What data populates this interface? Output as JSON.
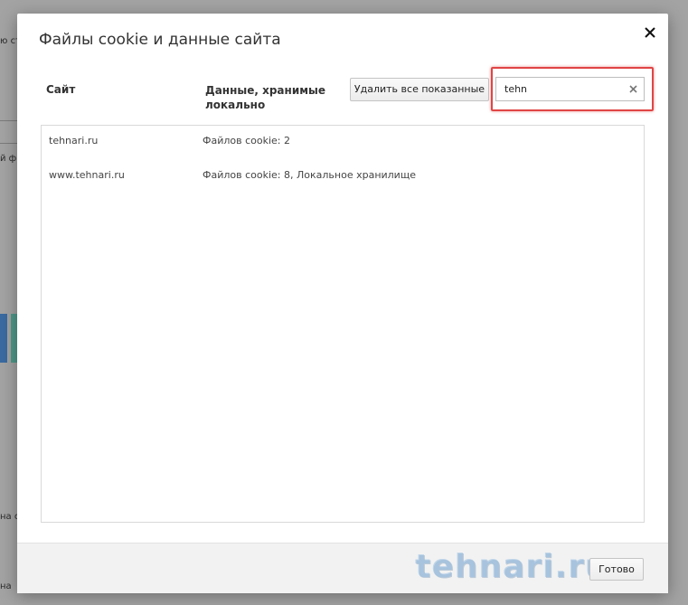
{
  "background": {
    "fragments": [
      "ю ст",
      "й ф",
      "на с",
      "на"
    ]
  },
  "dialog": {
    "title": "Файлы cookie и данные сайта",
    "close_icon": "close-icon"
  },
  "columns": {
    "site": "Сайт",
    "data": "Данные, хранимые локально"
  },
  "toolbar": {
    "remove_all_label": "Удалить все показанные"
  },
  "search": {
    "value": "tehn",
    "clear_icon": "clear-x-icon"
  },
  "sites": [
    {
      "site": "tehnari.ru",
      "data": "Файлов cookie: 2"
    },
    {
      "site": "www.tehnari.ru",
      "data": "Файлов cookie: 8, Локальное хранилище"
    }
  ],
  "footer": {
    "done_label": "Готово",
    "watermark": "tehnari.ru"
  },
  "colors": {
    "highlight": "#e04545",
    "overlay": "#a3a3a3"
  }
}
